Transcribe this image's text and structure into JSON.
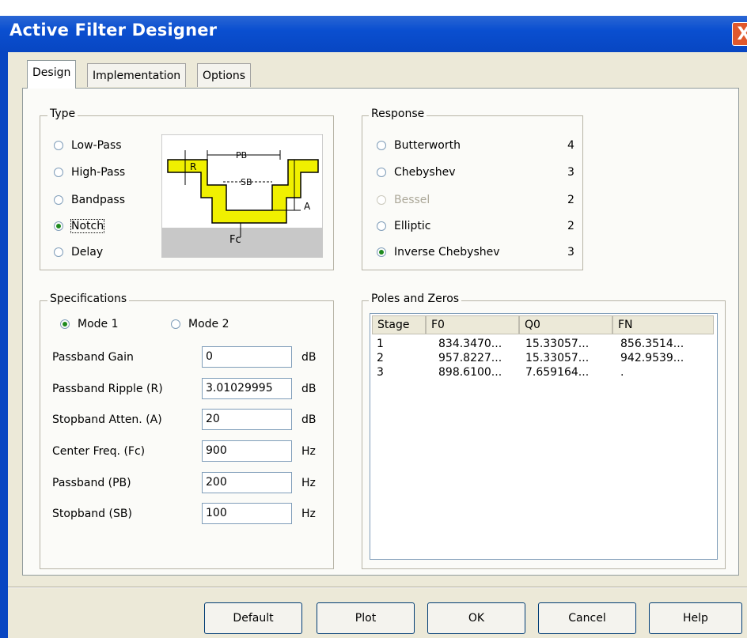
{
  "window": {
    "title": "Active Filter Designer",
    "close_glyph": "X"
  },
  "tabs": [
    "Design",
    "Implementation",
    "Options"
  ],
  "type_group": {
    "label": "Type",
    "options": [
      "Low-Pass",
      "High-Pass",
      "Bandpass",
      "Notch",
      "Delay"
    ],
    "selected": "Notch",
    "diagram": {
      "pb": "PB",
      "sb": "SB",
      "r": "R",
      "a": "A",
      "fc": "Fc"
    }
  },
  "response_group": {
    "label": "Response",
    "options": [
      {
        "label": "Butterworth",
        "order": "4",
        "enabled": true
      },
      {
        "label": "Chebyshev",
        "order": "3",
        "enabled": true
      },
      {
        "label": "Bessel",
        "order": "2",
        "enabled": false
      },
      {
        "label": "Elliptic",
        "order": "2",
        "enabled": true
      },
      {
        "label": "Inverse Chebyshev",
        "order": "3",
        "enabled": true
      }
    ],
    "selected": "Inverse Chebyshev"
  },
  "specifications": {
    "label": "Specifications",
    "modes": [
      "Mode 1",
      "Mode 2"
    ],
    "selected_mode": "Mode 1",
    "rows": [
      {
        "label": "Passband Gain",
        "value": "0",
        "unit": "dB"
      },
      {
        "label": "Passband Ripple (R)",
        "value": "3.01029995",
        "unit": "dB"
      },
      {
        "label": "Stopband Atten. (A)",
        "value": "20",
        "unit": "dB"
      },
      {
        "label": "Center Freq. (Fc)",
        "value": "900",
        "unit": "Hz"
      },
      {
        "label": "Passband (PB)",
        "value": "200",
        "unit": "Hz"
      },
      {
        "label": "Stopband (SB)",
        "value": "100",
        "unit": "Hz"
      }
    ]
  },
  "poles_zeros": {
    "label": "Poles and Zeros",
    "columns": [
      "Stage",
      "F0",
      "Q0",
      "FN"
    ],
    "rows": [
      [
        "1",
        "834.3470...",
        "15.33057...",
        "856.3514..."
      ],
      [
        "2",
        "957.8227...",
        "15.33057...",
        "942.9539..."
      ],
      [
        "3",
        "898.6100...",
        "7.659164...",
        "."
      ]
    ]
  },
  "buttons": [
    "Default",
    "Plot",
    "OK",
    "Cancel",
    "Help"
  ]
}
